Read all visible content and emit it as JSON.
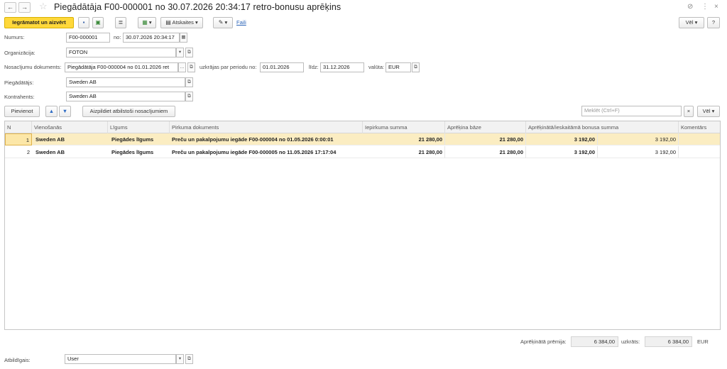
{
  "window": {
    "title": "Piegādātāja   F00-000001 no 30.07.2026 20:34:17 retro-bonusu aprēķins",
    "back_icon": "arrow-left-icon",
    "forward_icon": "arrow-right-icon",
    "favorite_icon": "star-icon",
    "link_icon": "link-icon",
    "more_icon": "more-vertical-icon",
    "close_icon": "close-icon"
  },
  "toolbar": {
    "post_close": "Iegrāmatot un aizvērt",
    "reports": "Atskaites",
    "files": "Faili",
    "more": "Vēl",
    "help": "?"
  },
  "form": {
    "number_label": "Numurs:",
    "number": "F00-000001",
    "from_label": "no:",
    "date": "30.07.2026 20:34:17",
    "org_label": "Organizācija:",
    "org": "FOTON",
    "terms_doc_label": "Nosacījumu dokuments:",
    "terms_doc": "Piegādātāja   F00-000004 no 01.01.2026 ret",
    "accum_label": "uzkrājas par periodu no:",
    "period_from": "01.01.2026",
    "until_label": "līdz:",
    "period_to": "31.12.2026",
    "currency_label": "valūta:",
    "currency": "EUR",
    "supplier_label": "Piegādātājs:",
    "supplier": "Sweden AB",
    "counterparty_label": "Kontrahents:",
    "counterparty": "Sweden AB",
    "responsible_label": "Atbildīgais:",
    "responsible": "User"
  },
  "table_toolbar": {
    "add": "Pievienot",
    "fill": "Aizpildiet atbilstoši nosacījumiem",
    "search_placeholder": "Meklēt (Ctrl+F)",
    "clear": "×",
    "more": "Vēl"
  },
  "table": {
    "columns": [
      "N",
      "Vienošanās",
      "Līgums",
      "Pirkuma dokuments",
      "Iepirkuma summa",
      "Aprēķina bāze",
      "Aprēķinātā/ieskaitāmā bonusa summa",
      "Komentārs"
    ],
    "rows": [
      {
        "n": "1",
        "agreement": "Sweden AB",
        "contract": "Piegādes līgums",
        "purchase_doc": "Preču un pakalpojumu iegāde   F00-000004 no 01.05.2026 0:00:01",
        "purchase_sum": "21 280,00",
        "base": "21 280,00",
        "bonus": "3 192,00",
        "bonus2": "3 192,00",
        "comment": ""
      },
      {
        "n": "2",
        "agreement": "Sweden AB",
        "contract": "Piegādes līgums",
        "purchase_doc": "Preču un pakalpojumu iegāde   F00-000005 no 11.05.2026 17:17:04",
        "purchase_sum": "21 280,00",
        "base": "21 280,00",
        "bonus": "3 192,00",
        "bonus2": "3 192,00",
        "comment": ""
      }
    ]
  },
  "totals": {
    "calc_label": "Aprēķinātā prēmija:",
    "calc": "6 384,00",
    "accrued_label": "uzkrāts:",
    "accrued": "6 384,00",
    "currency": "EUR"
  },
  "colors": {
    "primary_button": "#ffd83a",
    "selected_row": "#fbedc2",
    "link": "#2b64b8"
  }
}
